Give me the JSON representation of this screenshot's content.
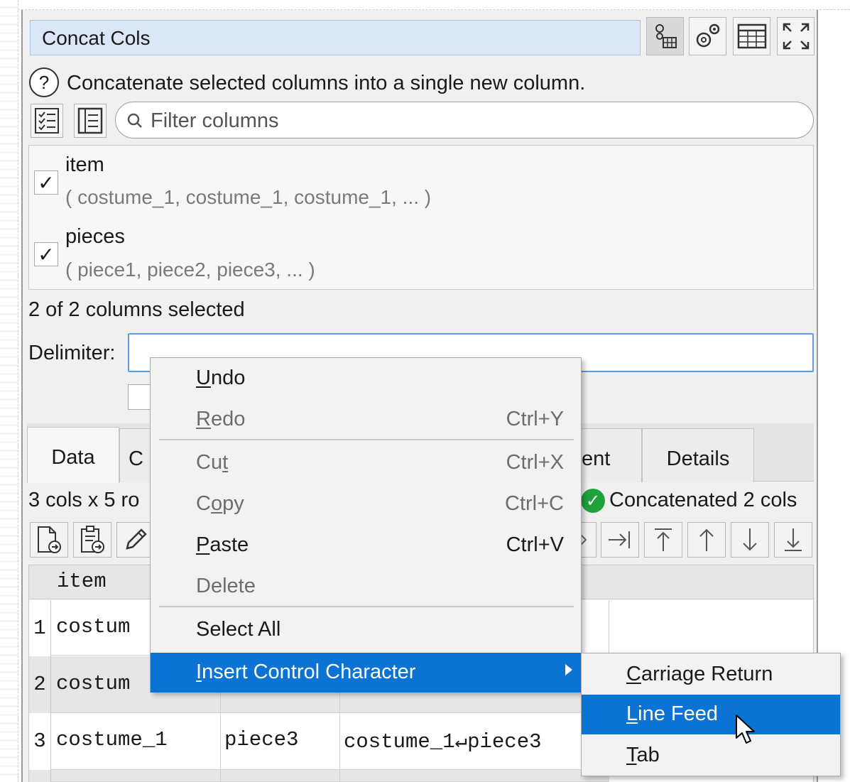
{
  "panel": {
    "title": "Concat Cols",
    "description": "Concatenate selected columns into a single new column.",
    "filter_placeholder": "Filter columns",
    "columns": [
      {
        "name": "item",
        "sample": "( costume_1, costume_1, costume_1, ... )",
        "checked": true
      },
      {
        "name": "pieces",
        "sample": "( piece1, piece2, piece3, ... )",
        "checked": true
      }
    ],
    "selected_count": "2 of 2 columns selected",
    "delimiter_label": "Delimiter:",
    "delimiter_value": ""
  },
  "toolbar_icons": [
    "column-calc-icon",
    "settings-gears-icon",
    "table-icon",
    "maximize-icon"
  ],
  "tabs": [
    "Data",
    "C",
    "ent",
    "Details"
  ],
  "status": {
    "left": "3 cols x 5 ro",
    "right": "Concatenated 2 cols",
    "ok_mark": "✓"
  },
  "grid": {
    "header_first": "item",
    "rows": [
      {
        "num": "1",
        "col1": "costum",
        "col2": "",
        "col3": ""
      },
      {
        "num": "2",
        "col1": "costum",
        "col2": "",
        "col3": ""
      },
      {
        "num": "3",
        "col1": "costume_1",
        "col2": "piece3",
        "col3": "costume_1↵piece3"
      }
    ]
  },
  "context_menu": {
    "items": [
      {
        "u": "U",
        "rest": "ndo",
        "shortcut": ""
      },
      {
        "u": "R",
        "rest": "edo",
        "shortcut": "Ctrl+Y"
      },
      {
        "pre": "Cu",
        "u": "t",
        "shortcut": "Ctrl+X"
      },
      {
        "pre": "C",
        "u": "o",
        "rest": "py",
        "shortcut": "Ctrl+C"
      },
      {
        "u": "P",
        "rest": "aste",
        "shortcut": "Ctrl+V"
      },
      {
        "label": "Delete"
      },
      {
        "label": "Select All"
      },
      {
        "u": "I",
        "rest": "nsert Control Character"
      }
    ]
  },
  "submenu": {
    "items": [
      {
        "u": "C",
        "rest": "arriage Return"
      },
      {
        "u": "L",
        "rest": "ine Feed"
      },
      {
        "u": "T",
        "rest": "ab"
      }
    ]
  },
  "colors": {
    "highlight": "#0a73d4",
    "title_bg": "#dbe7f6",
    "ok_green": "#1fa23b",
    "focus_border": "#5a9de0"
  }
}
